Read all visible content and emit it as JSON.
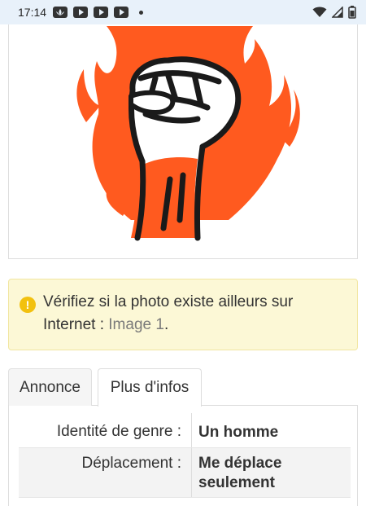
{
  "status_bar": {
    "time": "17:14",
    "icons": [
      "lotus-icon",
      "youtube-icon",
      "youtube-icon",
      "youtube-icon",
      "dot-icon"
    ],
    "right_icons": [
      "wifi-icon",
      "signal-icon",
      "battery-icon"
    ]
  },
  "photo": {
    "alt": "raised fist with flames",
    "colors": {
      "flame": "#ff5a1f",
      "outline": "#1a1a1a",
      "background": "#ffffff"
    }
  },
  "alert": {
    "text": "Vérifiez si la photo existe ailleurs sur Internet : ",
    "link": "Image 1",
    "suffix": ".",
    "icon": "info-icon",
    "colors": {
      "background": "#fcf8d6",
      "icon": "#f2c10f"
    }
  },
  "tabs": [
    {
      "label": "Annonce"
    },
    {
      "label": "Plus d'infos"
    }
  ],
  "info": {
    "rows": [
      {
        "label": "Identité de genre :",
        "value": "Un homme"
      },
      {
        "label": "Déplacement :",
        "value": "Me déplace seulement"
      }
    ]
  }
}
